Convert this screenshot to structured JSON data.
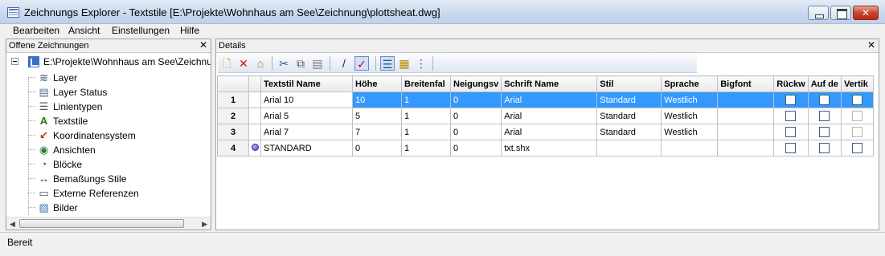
{
  "window": {
    "title": "Zeichnungs Explorer - Textstile [E:\\Projekte\\Wohnhaus am See\\Zeichnung\\plottsheat.dwg]"
  },
  "menu": [
    "Bearbeiten",
    "Ansicht",
    "Einstellungen",
    "Hilfe"
  ],
  "left_pane": {
    "title": "Offene Zeichnungen",
    "close_label": "✕",
    "root": "E:\\Projekte\\Wohnhaus am See\\Zeichnun",
    "items": [
      {
        "label": "Layer",
        "icon": "layers-icon"
      },
      {
        "label": "Layer Status",
        "icon": "layer-status-icon"
      },
      {
        "label": "Linientypen",
        "icon": "linetypes-icon"
      },
      {
        "label": "Textstile",
        "icon": "text-style-icon"
      },
      {
        "label": "Koordinatensystem",
        "icon": "coordinate-system-icon"
      },
      {
        "label": "Ansichten",
        "icon": "eye-icon"
      },
      {
        "label": "Blöcke",
        "icon": "block-icon"
      },
      {
        "label": "Bemaßungs Stile",
        "icon": "dimension-style-icon"
      },
      {
        "label": "Externe Referenzen",
        "icon": "xref-icon"
      },
      {
        "label": "Bilder",
        "icon": "image-icon"
      }
    ]
  },
  "details": {
    "title": "Details",
    "close_label": "✕",
    "toolbar": [
      "new-icon",
      "delete-icon",
      "purge-icon",
      "cut-icon",
      "copy-icon",
      "paste-icon",
      "edit-icon",
      "set-current-icon",
      "details-view-icon",
      "icon-view-icon",
      "tree-view-icon"
    ],
    "columns": [
      "Textstil Name",
      "Höhe",
      "Breitenfal",
      "Neigungsv",
      "Schrift Name",
      "Stil",
      "Sprache",
      "Bigfont",
      "Rückw",
      "Auf de",
      "Vertik"
    ],
    "rows": [
      {
        "num": "1",
        "name": "Arial 10",
        "hoehe": "10",
        "breite": "1",
        "neigung": "0",
        "schrift": "Arial",
        "stil": "Standard",
        "sprache": "Westlich",
        "bigfont": "",
        "rueckw": false,
        "aufde": false,
        "vertik": false,
        "current": false
      },
      {
        "num": "2",
        "name": "Arial 5",
        "hoehe": "5",
        "breite": "1",
        "neigung": "0",
        "schrift": "Arial",
        "stil": "Standard",
        "sprache": "Westlich",
        "bigfont": "",
        "rueckw": false,
        "aufde": false,
        "vertik": false,
        "current": false
      },
      {
        "num": "3",
        "name": "Arial 7",
        "hoehe": "7",
        "breite": "1",
        "neigung": "0",
        "schrift": "Arial",
        "stil": "Standard",
        "sprache": "Westlich",
        "bigfont": "",
        "rueckw": false,
        "aufde": false,
        "vertik": false,
        "current": false
      },
      {
        "num": "4",
        "name": "STANDARD",
        "hoehe": "0",
        "breite": "1",
        "neigung": "0",
        "schrift": "txt.shx",
        "stil": "",
        "sprache": "",
        "bigfont": "",
        "rueckw": false,
        "aufde": false,
        "vertik": false,
        "current": true
      }
    ]
  },
  "status": "Bereit"
}
